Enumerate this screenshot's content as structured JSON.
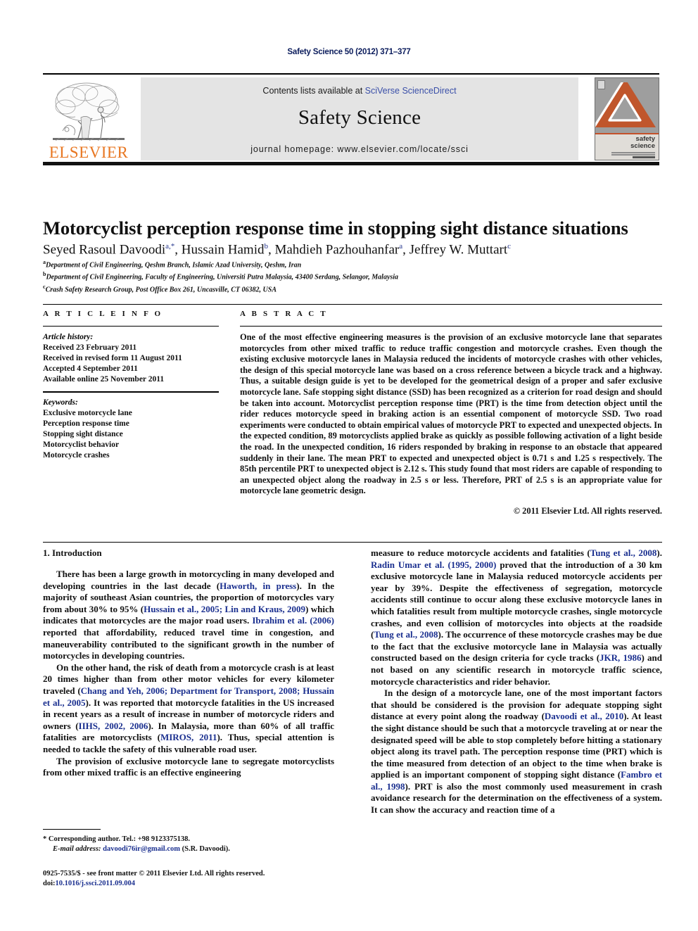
{
  "running_head": "Safety Science 50 (2012) 371–377",
  "masthead": {
    "contents_prefix": "Contents lists available at ",
    "sciencedirect": "SciVerse ScienceDirect",
    "journal_name": "Safety Science",
    "homepage": "journal homepage: www.elsevier.com/locate/ssci",
    "publisher_wordmark": "ELSEVIER",
    "cover_title_line1": "safety",
    "cover_title_line2": "science",
    "accent_orange": "#e87722",
    "link_blue": "#3a4fa8",
    "banner_grey": "#e4e4e4"
  },
  "article": {
    "title": "Motorcyclist perception response time in stopping sight distance situations",
    "authors": [
      {
        "name": "Seyed Rasoul Davoodi",
        "marks": "a,*"
      },
      {
        "name": "Hussain Hamid",
        "marks": "b"
      },
      {
        "name": "Mahdieh Pazhouhanfar",
        "marks": "a"
      },
      {
        "name": "Jeffrey W. Muttart",
        "marks": "c"
      }
    ],
    "affiliations": [
      {
        "mark": "a",
        "text": "Department of Civil Engineering, Qeshm Branch, Islamic Azad University, Qeshm, Iran"
      },
      {
        "mark": "b",
        "text": "Department of Civil Engineering, Faculty of Engineering, Universiti Putra Malaysia, 43400 Serdang, Selangor, Malaysia"
      },
      {
        "mark": "c",
        "text": "Crash Safety Research Group, Post Office Box 261, Uncasville, CT 06382, USA"
      }
    ]
  },
  "article_info": {
    "heading": "A R T I C L E   I N F O",
    "history_title": "Article history:",
    "history": [
      "Received 23 February 2011",
      "Received in revised form 11 August 2011",
      "Accepted 4 September 2011",
      "Available online 25 November 2011"
    ],
    "keywords_title": "Keywords:",
    "keywords": [
      "Exclusive motorcycle lane",
      "Perception response time",
      "Stopping sight distance",
      "Motorcyclist behavior",
      "Motorcycle crashes"
    ]
  },
  "abstract": {
    "heading": "A B S T R A C T",
    "body": "One of the most effective engineering measures is the provision of an exclusive motorcycle lane that separates motorcycles from other mixed traffic to reduce traffic congestion and motorcycle crashes. Even though the existing exclusive motorcycle lanes in Malaysia reduced the incidents of motorcycle crashes with other vehicles, the design of this special motorcycle lane was based on a cross reference between a bicycle track and a highway. Thus, a suitable design guide is yet to be developed for the geometrical design of a proper and safer exclusive motorcycle lane. Safe stopping sight distance (SSD) has been recognized as a criterion for road design and should be taken into account. Motorcyclist perception response time (PRT) is the time from detection object until the rider reduces motorcycle speed in braking action is an essential component of motorcycle SSD. Two road experiments were conducted to obtain empirical values of motorcycle PRT to expected and unexpected objects. In the expected condition, 89 motorcyclists applied brake as quickly as possible following activation of a light beside the road. In the unexpected condition, 16 riders responded by braking in response to an obstacle that appeared suddenly in their lane. The mean PRT to expected and unexpected object is 0.71 s and 1.25 s respectively. The 85th percentile PRT to unexpected object is 2.12 s. This study found that most riders are capable of responding to an unexpected object along the roadway in 2.5 s or less. Therefore, PRT of 2.5 s is an appropriate value for motorcycle lane geometric design.",
    "copyright": "© 2011 Elsevier Ltd. All rights reserved."
  },
  "section": {
    "number_title": "1. Introduction"
  },
  "body_left": {
    "p1_a": "There has been a large growth in motorcycling in many developed and developing countries in the last decade (",
    "p1_ref1": "Haworth, in press",
    "p1_b": "). In the majority of southeast Asian countries, the proportion of motorcycles vary from about 30% to 95% (",
    "p1_ref2": "Hussain et al., 2005; Lin and Kraus, 2009",
    "p1_c": ") which indicates that motorcycles are the major road users. ",
    "p1_ref3": "Ibrahim et al. (2006)",
    "p1_d": " reported that affordability, reduced travel time in congestion, and maneuverability contributed to the significant growth in the number of motorcycles in developing countries.",
    "p2_a": "On the other hand, the risk of death from a motorcycle crash is at least 20 times higher than from other motor vehicles for every kilometer traveled (",
    "p2_ref1": "Chang and Yeh, 2006; Department for Transport, 2008; Hussain et al., 2005",
    "p2_b": "). It was reported that motorcycle fatalities in the US increased in recent years as a result of increase in number of motorcycle riders and owners (",
    "p2_ref2": "IIHS, 2002, 2006",
    "p2_c": "). In Malaysia, more than 60% of all traffic fatalities are motorcyclists (",
    "p2_ref3": "MIROS, 2011",
    "p2_d": "). Thus, special attention is needed to tackle the safety of this vulnerable road user.",
    "p3_a": "The provision of exclusive motorcycle lane to segregate motorcyclists from other mixed traffic is an effective engineering"
  },
  "body_right": {
    "p1_a": "measure to reduce motorcycle accidents and fatalities (",
    "p1_ref1": "Tung et al., 2008",
    "p1_b": "). ",
    "p1_ref2": "Radin Umar et al. (1995, 2000)",
    "p1_c": " proved that the introduction of a 30 km exclusive motorcycle lane in Malaysia reduced motorcycle accidents per year by 39%. Despite the effectiveness of segregation, motorcycle accidents still continue to occur along these exclusive motorcycle lanes in which fatalities result from multiple motorcycle crashes, single motorcycle crashes, and even collision of motorcycles into objects at the roadside (",
    "p1_ref3": "Tung et al., 2008",
    "p1_d": "). The occurrence of these motorcycle crashes may be due to the fact that the exclusive motorcycle lane in Malaysia was actually constructed based on the design criteria for cycle tracks (",
    "p1_ref4": "JKR, 1986",
    "p1_e": ") and not based on any scientific research in motorcycle traffic science, motorcycle characteristics and rider behavior.",
    "p2_a": "In the design of a motorcycle lane, one of the most important factors that should be considered is the provision for adequate stopping sight distance at every point along the roadway (",
    "p2_ref1": "Davoodi et al., 2010",
    "p2_b": "). At least the sight distance should be such that a motorcycle traveling at or near the designated speed will be able to stop completely before hitting a stationary object along its travel path. The perception response time (PRT) which is the time measured from detection of an object to the time when brake is applied is an important component of stopping sight distance (",
    "p2_ref2": "Fambro et al., 1998",
    "p2_c": "). PRT is also the most commonly used measurement in crash avoidance research for the determination on the effectiveness of a system. It can show the accuracy and reaction time of a"
  },
  "footnote": {
    "corresponding": "* Corresponding author. Tel.: +98 9123375138.",
    "email_label": "E-mail address:",
    "email": "davoodi76ir@gmail.com",
    "email_suffix": "(S.R. Davoodi)."
  },
  "colophon": {
    "line1": "0925-7535/$ - see front matter © 2011 Elsevier Ltd. All rights reserved.",
    "doi_label": "doi:",
    "doi": "10.1016/j.ssci.2011.09.004"
  }
}
